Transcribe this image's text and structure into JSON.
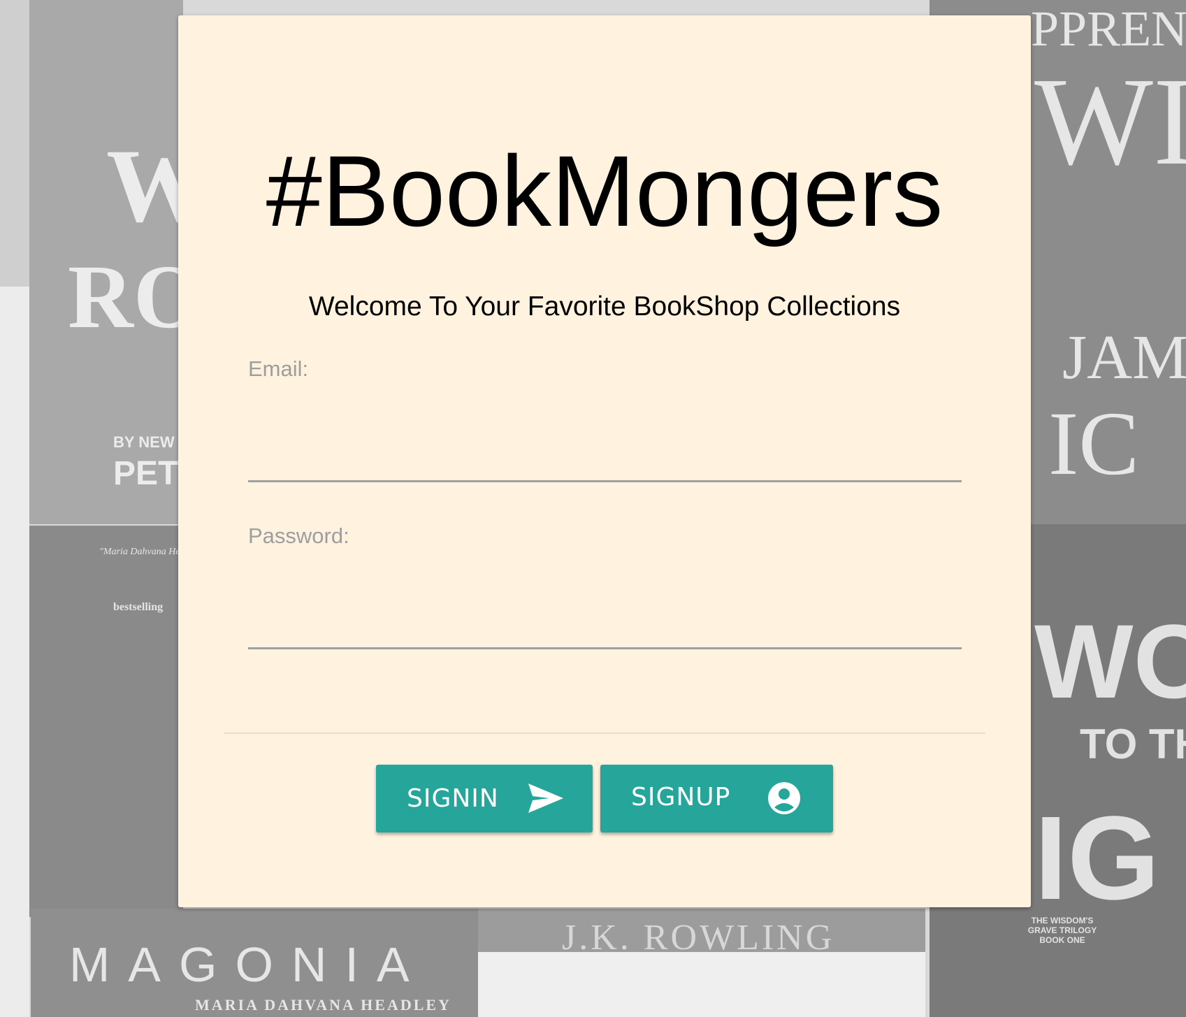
{
  "app": {
    "title": "#BookMongers",
    "subtitle": "Welcome To Your Favorite BookShop Collections"
  },
  "form": {
    "email_label": "Email:",
    "email_value": "",
    "password_label": "Password:",
    "password_value": ""
  },
  "buttons": {
    "signin_label": "SIGNIN",
    "signin_icon": "send-icon",
    "signup_label": "SIGNUP",
    "signup_icon": "account-circle-icon"
  },
  "background": {
    "covers": [
      {
        "text": "W",
        "text2": "RO",
        "text3": "BY NEW Y",
        "text4": "PET"
      },
      {
        "text": "PPREN",
        "text2": "WIT",
        "text3": "JAM",
        "text4": "IC"
      },
      {
        "text": "\"Maria Dahvana Headley",
        "text2": "bestselling"
      },
      {
        "text": "WO",
        "text2": "TO TH",
        "text3": "IG",
        "text4": "THE WISDOM'S GRAVE TRILOGY BOOK ONE"
      },
      {
        "text": "MAGONIA",
        "text2": "MARIA DAHVANA HEADLEY"
      },
      {
        "text": "J.K. ROWLING"
      }
    ]
  },
  "colors": {
    "card_bg": "#fff3e0",
    "accent": "#26a69a",
    "label": "#9e9e9e"
  }
}
